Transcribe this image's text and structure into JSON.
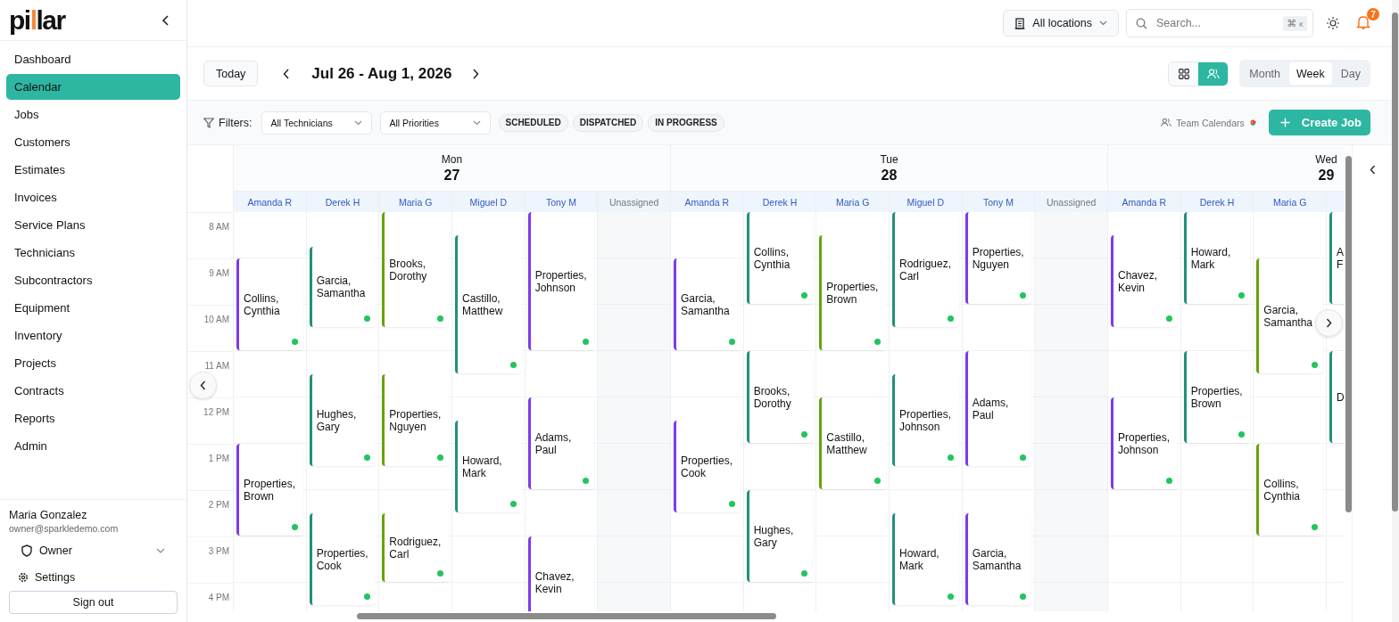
{
  "sidebar": {
    "logo": "pillar",
    "items": [
      {
        "label": "Dashboard",
        "selected": false
      },
      {
        "label": "Calendar",
        "selected": true
      },
      {
        "label": "Jobs",
        "selected": false
      },
      {
        "label": "Customers",
        "selected": false
      },
      {
        "label": "Estimates",
        "selected": false
      },
      {
        "label": "Invoices",
        "selected": false
      },
      {
        "label": "Service Plans",
        "selected": false
      },
      {
        "label": "Technicians",
        "selected": false
      },
      {
        "label": "Subcontractors",
        "selected": false
      },
      {
        "label": "Equipment",
        "selected": false
      },
      {
        "label": "Inventory",
        "selected": false
      },
      {
        "label": "Projects",
        "selected": false
      },
      {
        "label": "Contracts",
        "selected": false
      },
      {
        "label": "Reports",
        "selected": false
      },
      {
        "label": "Admin",
        "selected": false
      }
    ],
    "user": {
      "name": "Maria Gonzalez",
      "email": "owner@sparkledemo.com",
      "role": "Owner"
    },
    "settings": "Settings",
    "sign_out": "Sign out"
  },
  "topbar": {
    "location": "All locations",
    "search_placeholder": "Search...",
    "shortcut": [
      "⌘",
      "K"
    ],
    "notifications": "7"
  },
  "toolbar": {
    "today": "Today",
    "range": "Jul 26 - Aug 1, 2026",
    "layouts": [
      {
        "kind": "grid",
        "selected": false
      },
      {
        "kind": "team",
        "selected": true
      }
    ],
    "views": [
      {
        "label": "Month",
        "selected": false
      },
      {
        "label": "Week",
        "selected": true
      },
      {
        "label": "Day",
        "selected": false
      }
    ]
  },
  "filters": {
    "label": "Filters:",
    "selects": [
      "All Technicians",
      "All Priorities"
    ],
    "chips": [
      "SCHEDULED",
      "DISPATCHED",
      "IN PROGRESS"
    ],
    "team_calendars": "Team Calendars",
    "create": "Create Job"
  },
  "calendar": {
    "hours": [
      "8 AM",
      "9 AM",
      "10 AM",
      "11 AM",
      "12 PM",
      "1 PM",
      "2 PM",
      "3 PM",
      "4 PM"
    ],
    "days": [
      {
        "weekday": "Mon",
        "date": "27",
        "columns": [
          {
            "name": "Amanda R",
            "kind": "technician",
            "color": "#7c3aed",
            "events": [
              {
                "title": "Collins, Cynthia"
              },
              {
                "title": "Properties, Brown"
              }
            ]
          },
          {
            "name": "Derek H",
            "kind": "technician",
            "color": "#23907a",
            "events": [
              {
                "title": "Garcia, Samantha"
              },
              {
                "title": "Hughes, Gary"
              },
              {
                "title": "Properties, Cook"
              }
            ]
          },
          {
            "name": "Maria G",
            "kind": "technician",
            "color": "#65a30d",
            "events": [
              {
                "title": "Brooks, Dorothy"
              },
              {
                "title": "Properties, Nguyen"
              },
              {
                "title": "Rodriguez, Carl"
              }
            ]
          },
          {
            "name": "Miguel D",
            "kind": "technician",
            "color": "#23907a",
            "events": [
              {
                "title": "Castillo, Matthew"
              },
              {
                "title": "Howard, Mark"
              }
            ]
          },
          {
            "name": "Tony M",
            "kind": "technician",
            "color": "#7c3aed",
            "events": [
              {
                "title": "Properties, Johnson"
              },
              {
                "title": "Adams, Paul"
              },
              {
                "title": "Chavez, Kevin"
              }
            ]
          },
          {
            "name": "Unassigned",
            "kind": "unassigned"
          }
        ]
      },
      {
        "weekday": "Tue",
        "date": "28",
        "columns": [
          {
            "name": "Amanda R",
            "kind": "technician",
            "color": "#7c3aed",
            "events": [
              {
                "title": "Garcia, Samantha"
              },
              {
                "title": "Properties, Cook"
              }
            ]
          },
          {
            "name": "Derek H",
            "kind": "technician",
            "color": "#23907a",
            "events": [
              {
                "title": "Collins, Cynthia"
              },
              {
                "title": "Brooks, Dorothy"
              },
              {
                "title": "Hughes, Gary"
              }
            ]
          },
          {
            "name": "Maria G",
            "kind": "technician",
            "color": "#65a30d",
            "events": [
              {
                "title": "Properties, Brown"
              },
              {
                "title": "Castillo, Matthew"
              }
            ]
          },
          {
            "name": "Miguel D",
            "kind": "technician",
            "color": "#23907a",
            "events": [
              {
                "title": "Rodriguez, Carl"
              },
              {
                "title": "Properties, Johnson"
              },
              {
                "title": "Howard, Mark"
              }
            ]
          },
          {
            "name": "Tony M",
            "kind": "technician",
            "color": "#7c3aed",
            "events": [
              {
                "title": "Properties, Nguyen"
              },
              {
                "title": "Adams, Paul"
              },
              {
                "title": "Garcia, Samantha"
              }
            ]
          },
          {
            "name": "Unassigned",
            "kind": "unassigned"
          }
        ]
      },
      {
        "weekday": "Wed",
        "date": "29",
        "columns": [
          {
            "name": "Amanda R",
            "kind": "technician",
            "color": "#7c3aed",
            "events": [
              {
                "title": "Chavez, Kevin"
              },
              {
                "title": "Properties, Johnson"
              }
            ]
          },
          {
            "name": "Derek H",
            "kind": "technician",
            "color": "#23907a",
            "events": [
              {
                "title": "Howard, Mark"
              },
              {
                "title": "Properties, Brown"
              }
            ]
          },
          {
            "name": "Maria G",
            "kind": "technician",
            "color": "#65a30d",
            "events": [
              {
                "title": "Garcia, Samantha"
              },
              {
                "title": "Collins, Cynthia"
              }
            ]
          },
          {
            "kind": "technician",
            "color": "#23907a",
            "events": [
              {
                "title": "A\nF"
              },
              {
                "title": "D"
              }
            ]
          }
        ]
      }
    ]
  }
}
